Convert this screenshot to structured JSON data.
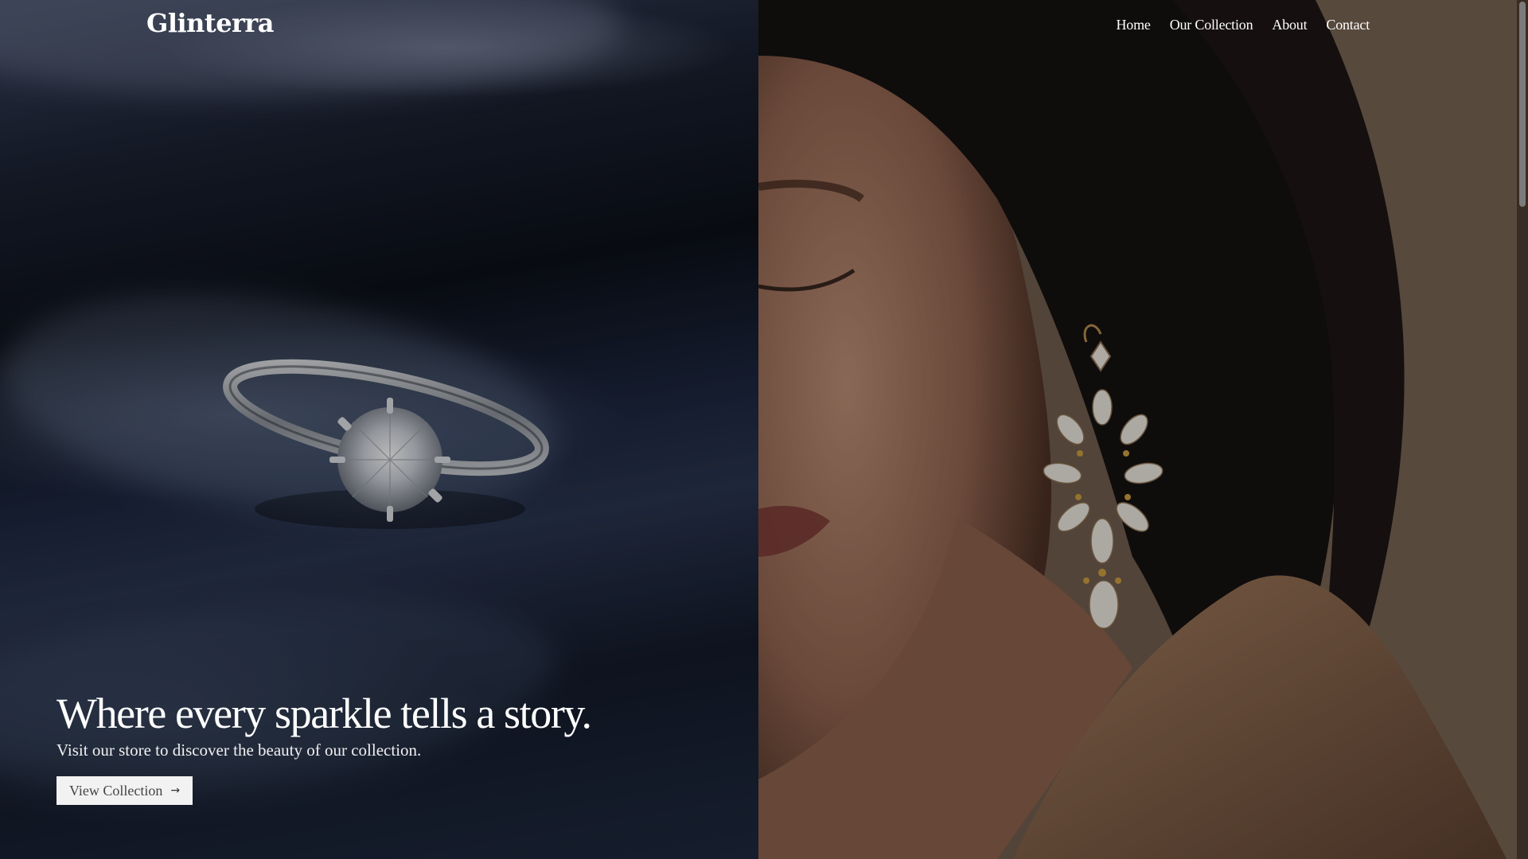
{
  "brand": {
    "logo_text": "Glinterra"
  },
  "nav": {
    "items": [
      {
        "label": "Home"
      },
      {
        "label": "Our Collection"
      },
      {
        "label": "About"
      },
      {
        "label": "Contact"
      }
    ]
  },
  "hero": {
    "title": "Where every sparkle tells a story.",
    "subtitle": "Visit our store to discover the beauty of our collection.",
    "cta_label": "View Collection",
    "cta_icon": "arrow-right-icon"
  },
  "images": {
    "left": "diamond-ring-on-navy-satin",
    "right": "woman-wearing-crystal-chandelier-earring"
  },
  "colors": {
    "text": "#ffffff",
    "button_bg": "#f2f2f2",
    "button_text": "#444444"
  }
}
